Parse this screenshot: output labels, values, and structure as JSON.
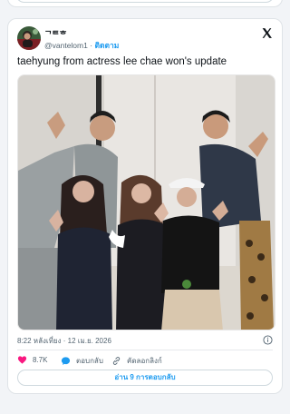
{
  "tweet": {
    "display_name": "ᄀᄐᄒ",
    "handle": "@vantelom1",
    "separator": "·",
    "follow_label": "ติดตาม",
    "text": "taehyung from actress lee chae won's update",
    "time": "8:22 หลังเที่ยง",
    "date": "12 เม.ย. 2026",
    "likes_count": "8.7K",
    "reply_label": "ตอบกลับ",
    "copy_link_label": "คัดลอกลิงก์",
    "read_replies_label": "อ่าน 9 การตอบกลับ"
  },
  "icons": {
    "logo": "x-logo-icon",
    "info": "info-icon",
    "like": "heart-icon",
    "reply": "speech-bubble-icon",
    "copy": "link-icon"
  },
  "colors": {
    "accent": "#1d9bf0",
    "like": "#f91880",
    "text": "#0f1419",
    "muted": "#536471"
  }
}
